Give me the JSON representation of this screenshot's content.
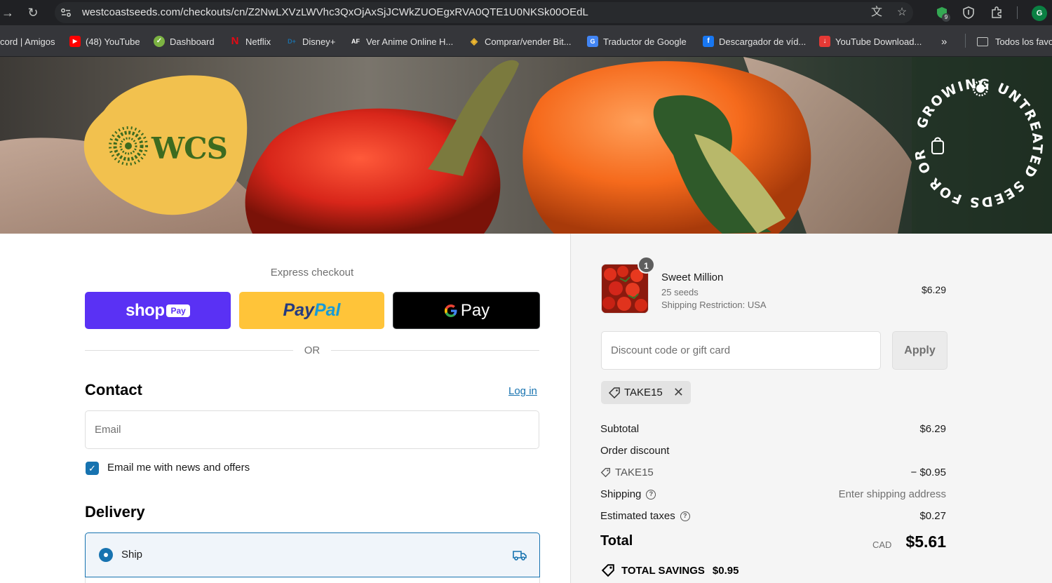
{
  "browser": {
    "url": "westcoastseeds.com/checkouts/cn/Z2NwLXVzLWVhc3QxOjAxSjJCWkZUOEgxRVA0QTE1U0NKSk00OEdL",
    "profile_initial": "G",
    "extension_badge": "9",
    "bookmarks": [
      {
        "label": "cord | Amigos",
        "icon": "discord-icon"
      },
      {
        "label": "(48) YouTube",
        "icon": "youtube-icon"
      },
      {
        "label": "Dashboard",
        "icon": "dashboard-icon"
      },
      {
        "label": "Netflix",
        "icon": "netflix-icon"
      },
      {
        "label": "Disney+",
        "icon": "disney-icon"
      },
      {
        "label": "Ver Anime Online H...",
        "icon": "animeflv-icon"
      },
      {
        "label": "Comprar/vender Bit...",
        "icon": "binance-icon"
      },
      {
        "label": "Traductor de Google",
        "icon": "translate-icon"
      },
      {
        "label": "Descargador de víd...",
        "icon": "facebook-icon"
      },
      {
        "label": "YouTube Download...",
        "icon": "download-icon"
      }
    ],
    "more_bookmarks": "»",
    "all_bookmarks": "Todos los favo"
  },
  "banner": {
    "logo_text": "WCS",
    "badge_text": "GROWING UNTREATED SEEDS FOR ORGANIC"
  },
  "checkout": {
    "express_label": "Express checkout",
    "shop_pay_label": "shop",
    "shop_pay_pill": "Pay",
    "paypal_label_1": "Pay",
    "paypal_label_2": "Pal",
    "gpay_label": "Pay",
    "or_label": "OR",
    "contact_title": "Contact",
    "login_label": "Log in",
    "email_placeholder": "Email",
    "newsletter_label": "Email me with news and offers",
    "newsletter_checked": true,
    "delivery_title": "Delivery",
    "ship_label": "Ship"
  },
  "summary": {
    "item": {
      "quantity": "1",
      "name": "Sweet Million",
      "variant": "25 seeds",
      "restriction": "Shipping Restriction: USA",
      "price": "$6.29"
    },
    "discount_placeholder": "Discount code or gift card",
    "apply_label": "Apply",
    "applied_code": "TAKE15",
    "subtotal_label": "Subtotal",
    "subtotal_value": "$6.29",
    "order_discount_label": "Order discount",
    "discount_code_label": "TAKE15",
    "discount_value": "− $0.95",
    "shipping_label": "Shipping",
    "shipping_value": "Enter shipping address",
    "taxes_label": "Estimated taxes",
    "taxes_value": "$0.27",
    "total_label": "Total",
    "currency": "CAD",
    "total_value": "$5.61",
    "savings_label": "TOTAL SAVINGS",
    "savings_value": "$0.95"
  },
  "colors": {
    "accent": "#1773b0",
    "shop_pay": "#5a31f4",
    "paypal": "#ffc439",
    "logo_yellow": "#f2c14e",
    "logo_green": "#3d6b1f"
  }
}
